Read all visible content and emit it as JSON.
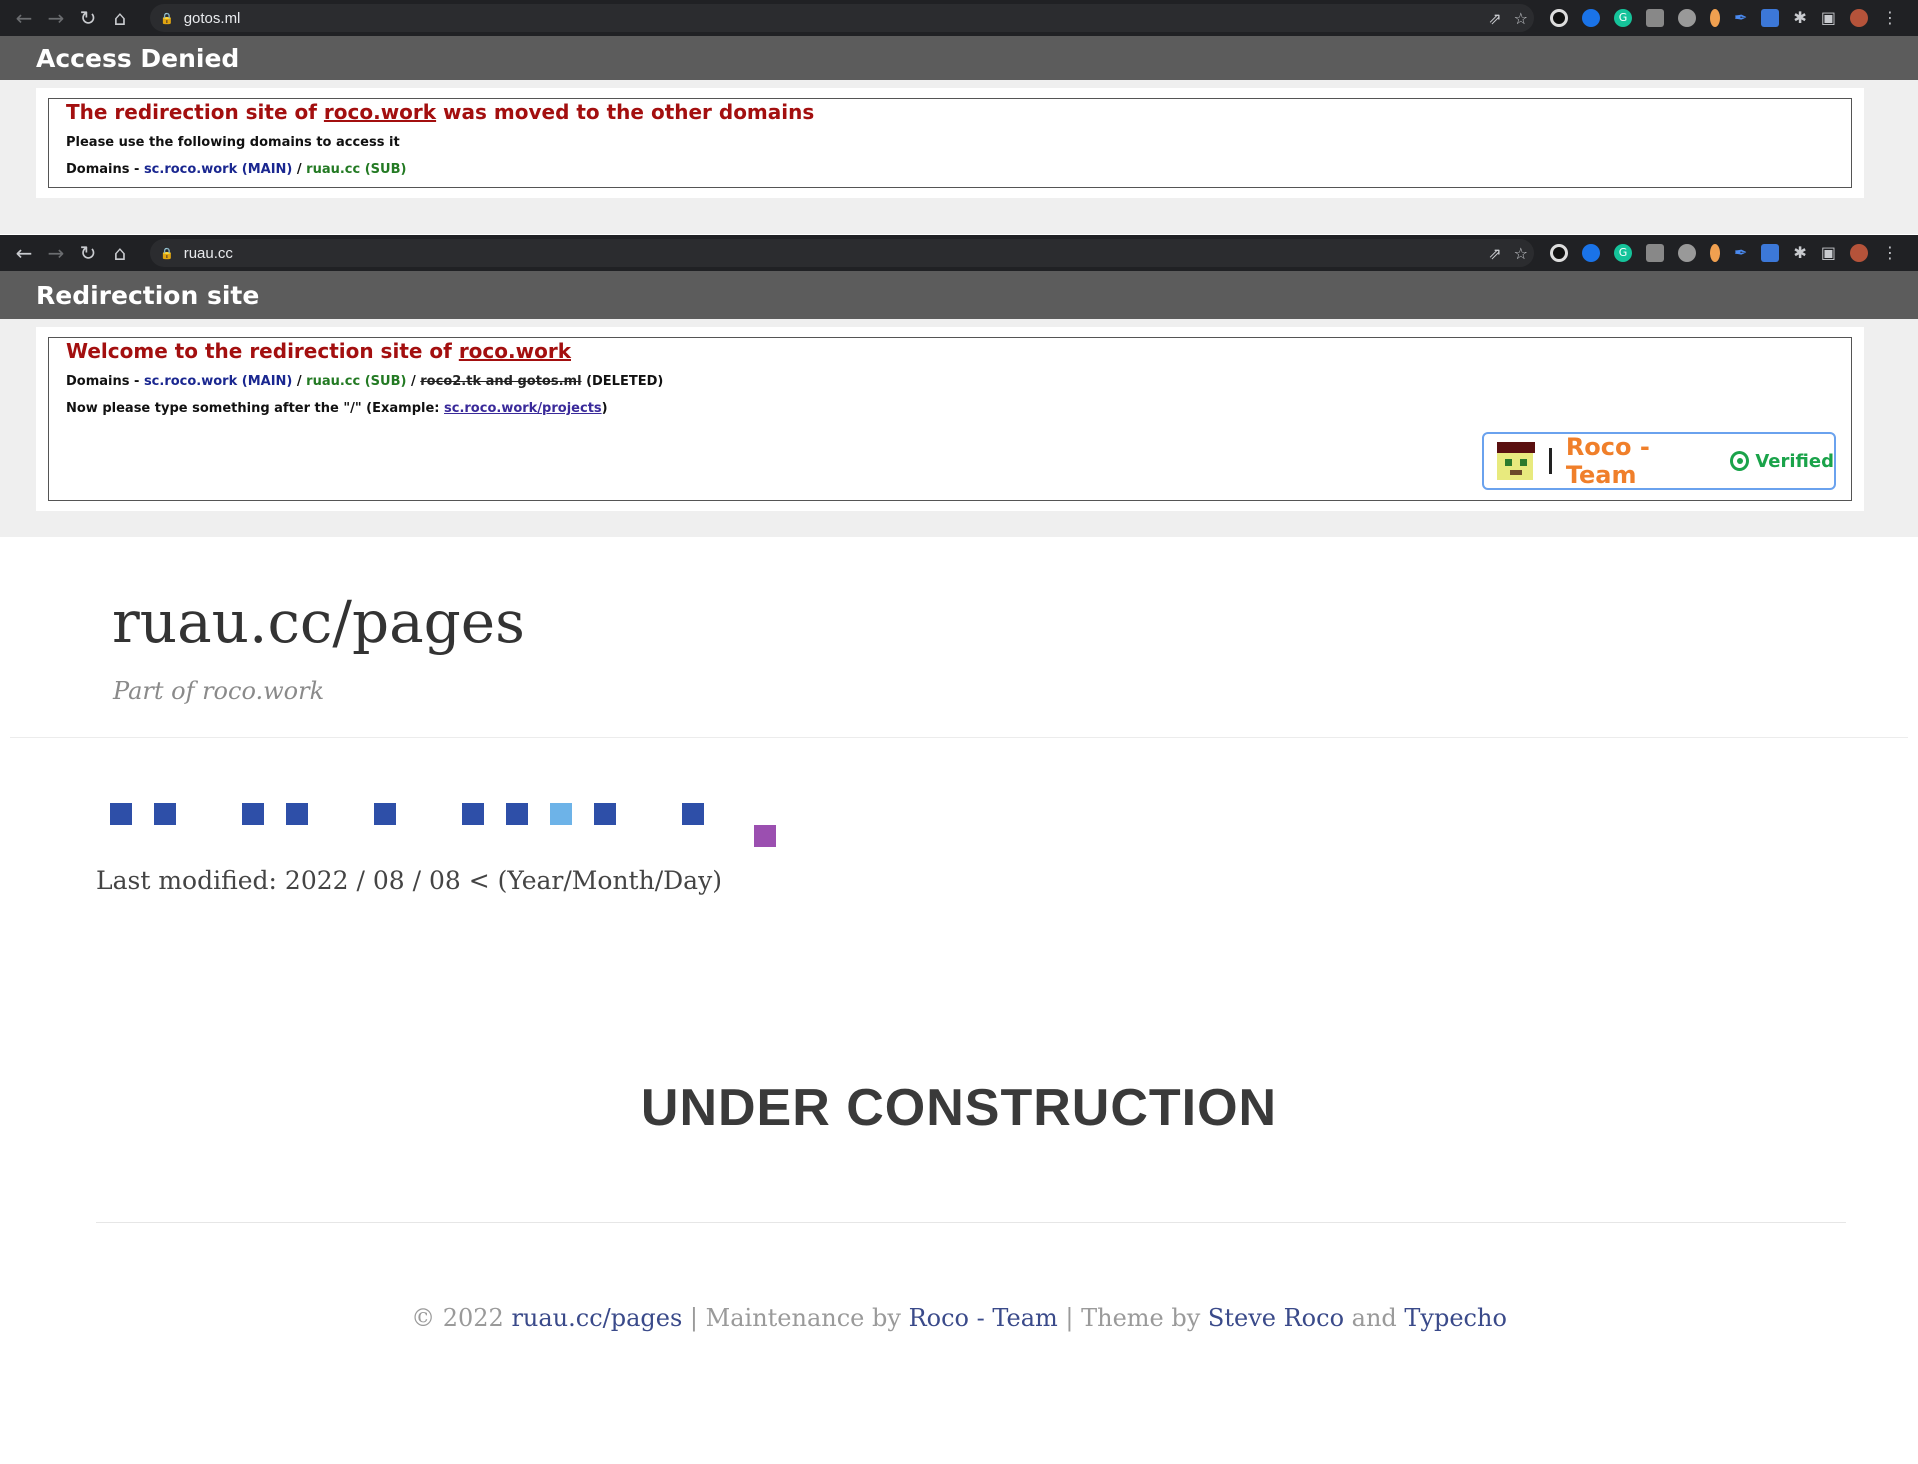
{
  "windows": [
    {
      "url": "gotos.ml",
      "site_header": "Access Denied",
      "heading_prefix": "The redirection site of ",
      "heading_link": "roco.work",
      "heading_suffix": " was moved to the other domains",
      "line1": "Please use the following domains to access it",
      "domains_label": "Domains - ",
      "main_domain": "sc.roco.work (MAIN)",
      "separator": " / ",
      "sub_domain": "ruau.cc (SUB)"
    },
    {
      "url": "ruau.cc",
      "site_header": "Redirection site",
      "heading_prefix": "Welcome to the redirection site of ",
      "heading_link": "roco.work",
      "domains_label": "Domains - ",
      "main_domain": "sc.roco.work (MAIN)",
      "separator": " / ",
      "sub_domain": "ruau.cc (SUB)",
      "deleted_domains": "roco2.tk and gotos.ml",
      "deleted_label": " (DELETED)",
      "instruction_prefix": "Now please type something after the \"/\" (Example: ",
      "instruction_link": "sc.roco.work/projects",
      "instruction_suffix": ")",
      "badge": {
        "team": "Roco - Team",
        "verified": "Verified"
      }
    }
  ],
  "blog": {
    "title": "ruau.cc/pages",
    "subtitle": "Part of roco.work",
    "squares": [
      {
        "color": "#2e4fa8",
        "row": 0
      },
      {
        "color": "#2e4fa8",
        "row": 0
      },
      {
        "color": "#2e4fa8",
        "row": 0
      },
      {
        "color": "#2e4fa8",
        "row": 0
      },
      {
        "color": "#2e4fa8",
        "row": 0
      },
      {
        "color": "#2e4fa8",
        "row": 0
      },
      {
        "color": "#2e4fa8",
        "row": 0
      },
      {
        "color": "#6db3e8",
        "row": 0
      },
      {
        "color": "#2e4fa8",
        "row": 0
      },
      {
        "color": "#2e4fa8",
        "row": 0
      },
      {
        "color": "#9b4fb0",
        "row": 1
      }
    ],
    "last_modified": "Last modified:  2022 / 08 / 08 < (Year/Month/Day)",
    "under_construction": "UNDER CONSTRUCTION",
    "footer": {
      "copyright": "© 2022 ",
      "site_link": "ruau.cc/pages",
      "maint_text": " | Maintenance by ",
      "team_link": "Roco - Team",
      "theme_text": " | Theme by ",
      "author_link": "Steve Roco",
      "and_text": " and ",
      "engine_link": "Typecho"
    }
  },
  "colors": {
    "chrome_bg": "#202124",
    "site_header_bg": "#5c5c5c",
    "heading_red": "#a30f0f",
    "main_domain": "#1a2790",
    "sub_domain": "#237a23",
    "team_orange": "#f07f2a",
    "verified_green": "#1aa34a"
  },
  "icons": {
    "back": "back-arrow-icon",
    "forward": "forward-arrow-icon",
    "reload": "reload-icon",
    "home": "home-icon",
    "lock": "lock-icon",
    "share": "share-icon",
    "bookmark": "star-icon",
    "extensions": "puzzle-icon",
    "sidebar": "side-panel-icon",
    "menu": "kebab-menu-icon"
  }
}
